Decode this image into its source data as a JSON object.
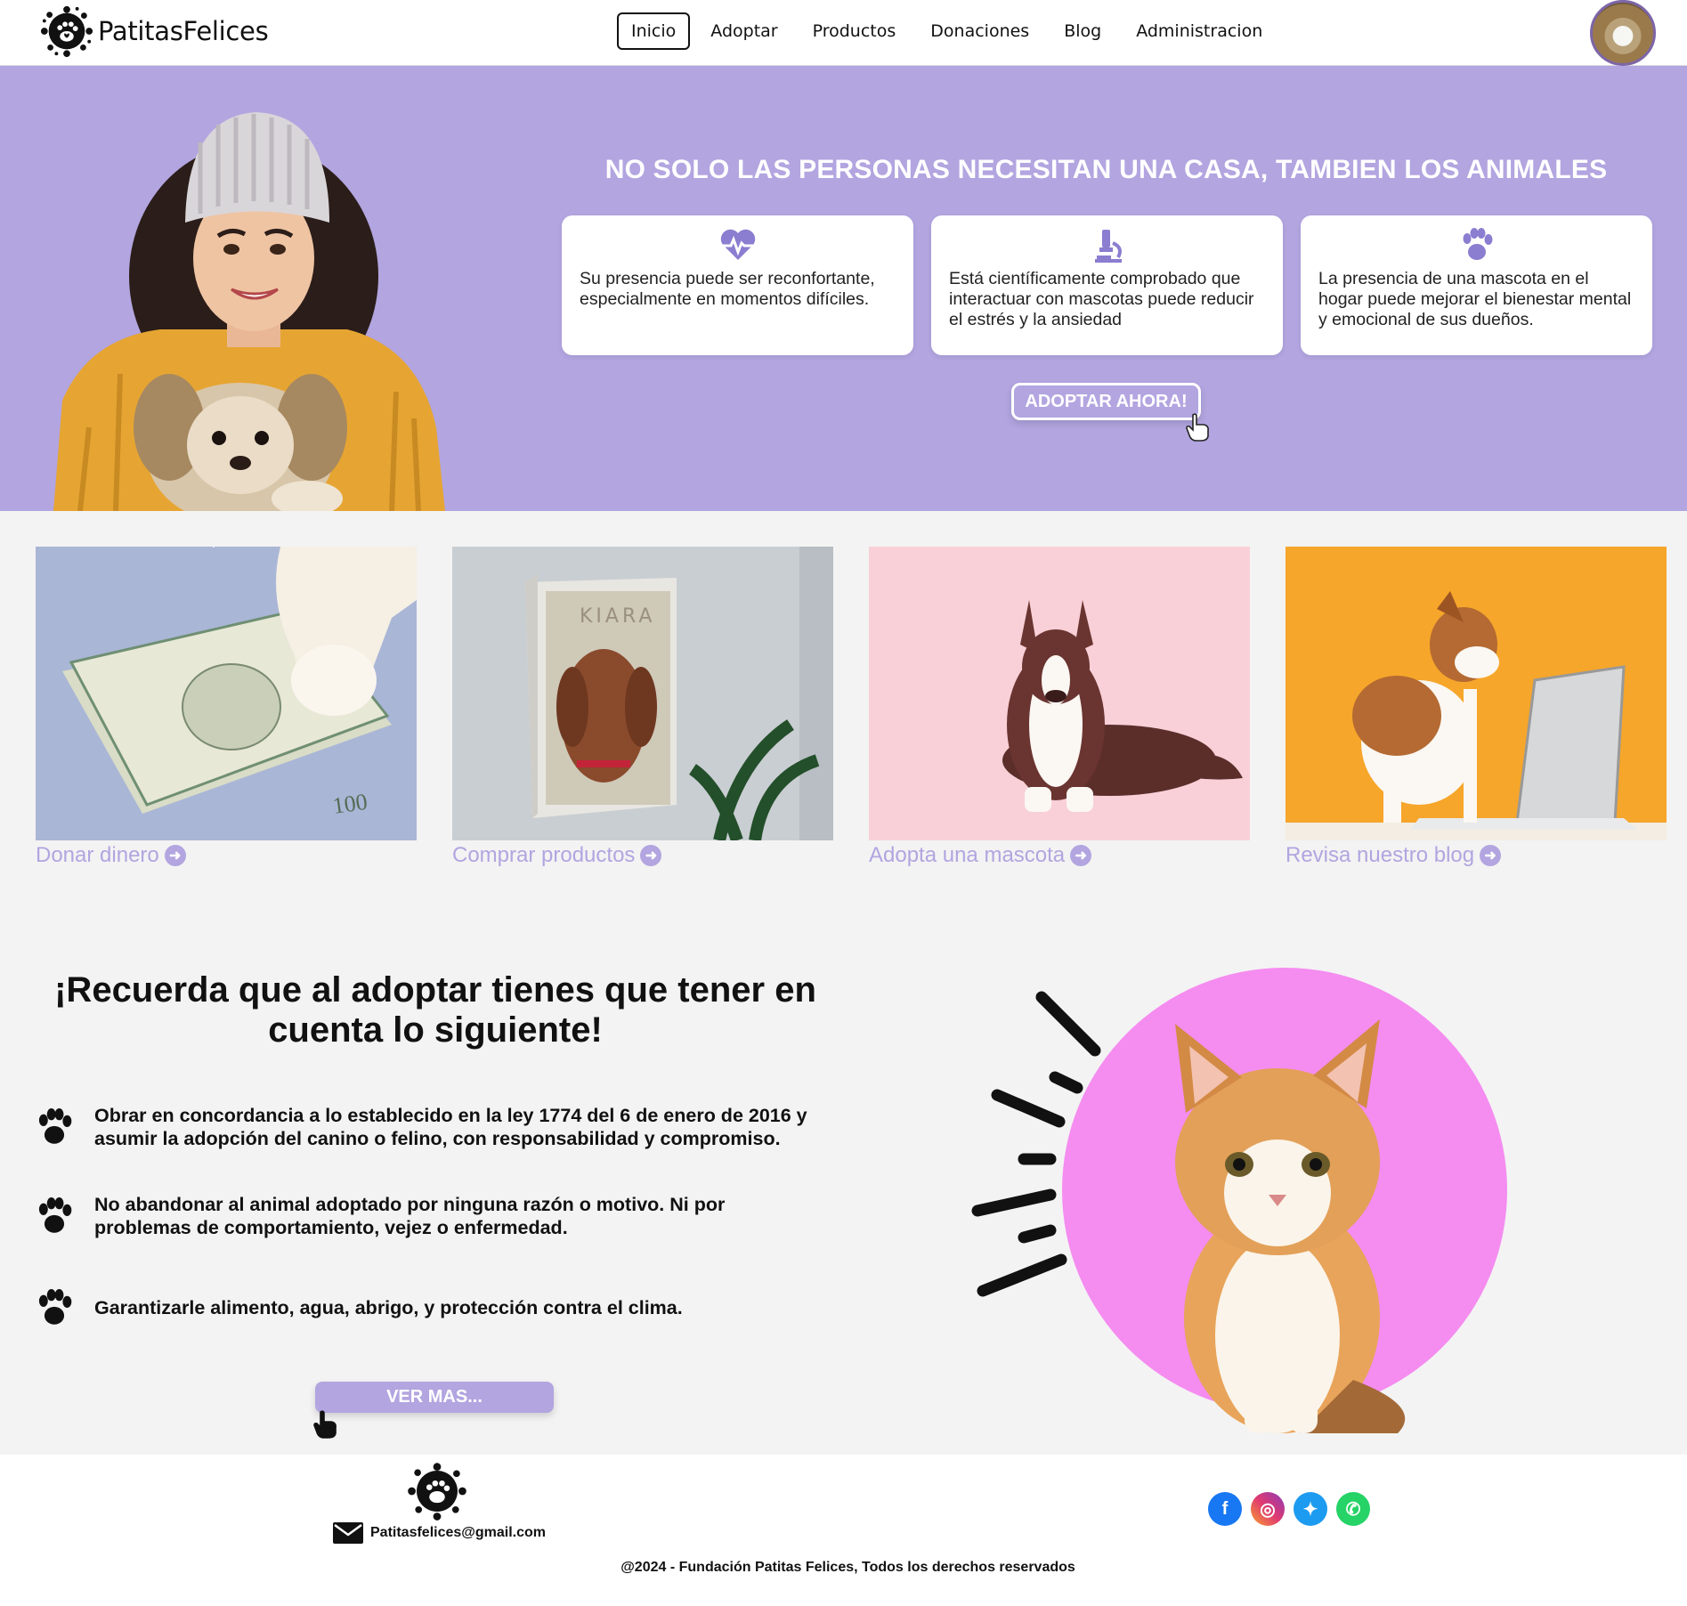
{
  "nav": {
    "brand": "PatitasFelices",
    "items": [
      "Inicio",
      "Adoptar",
      "Productos",
      "Donaciones",
      "Blog",
      "Administracion"
    ],
    "active": "Inicio"
  },
  "hero": {
    "title": "NO SOLO LAS PERSONAS NECESITAN UNA CASA, TAMBIEN LOS ANIMALES",
    "cards": [
      {
        "icon": "heart-pulse-icon",
        "text": "Su presencia puede ser reconfortante, especialmente en momentos difíciles."
      },
      {
        "icon": "microscope-icon",
        "text": "Está científicamente comprobado que interactuar con mascotas puede reducir el estrés y la ansiedad"
      },
      {
        "icon": "paw-icon",
        "text": "La presencia de una mascota en el hogar puede mejorar el bienestar mental y emocional de sus dueños."
      }
    ],
    "cta": "ADOPTAR AHORA!"
  },
  "tiles": [
    {
      "label": "Donar dinero"
    },
    {
      "label": "Comprar productos",
      "portrait_name": "KIARA"
    },
    {
      "label": "Adopta una mascota"
    },
    {
      "label": "Revisa nuestro blog"
    }
  ],
  "reminder": {
    "title": "¡Recuerda que al adoptar tienes que tener en cuenta lo siguiente!",
    "rules": [
      "Obrar en concordancia a lo establecido en la ley 1774 del 6 de enero de 2016 y asumir la adopción del canino o felino, con responsabilidad y compromiso.",
      "No abandonar al animal adoptado por ninguna razón o motivo. Ni por problemas de comportamiento, vejez o enfermedad.",
      "Garantizarle alimento, agua, abrigo, y protección contra el clima."
    ],
    "more": "VER MAS..."
  },
  "footer": {
    "email": "Patitasfelices@gmail.com",
    "social": [
      "facebook-icon",
      "instagram-icon",
      "twitter-icon",
      "whatsapp-icon"
    ],
    "copyright": "@2024 - Fundación Patitas Felices, Todos los derechos reservados"
  },
  "colors": {
    "accent": "#b2a5e0",
    "pink_circle": "#f58cf0",
    "background": "#f3f3f3"
  }
}
